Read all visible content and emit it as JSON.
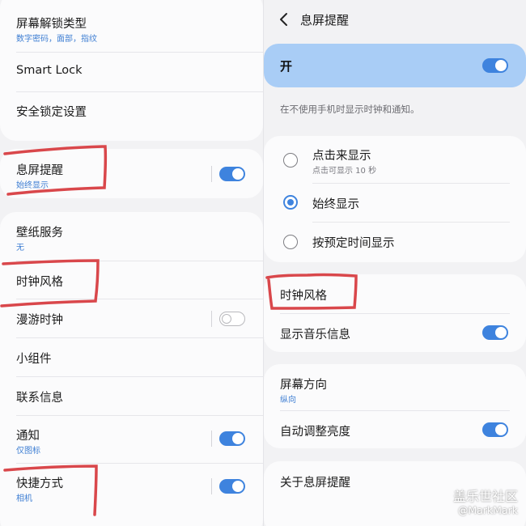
{
  "left": {
    "screen_lock_type": {
      "title": "屏幕解锁类型",
      "subtitle": "数字密码，面部，指纹"
    },
    "smart_lock": {
      "title": "Smart Lock"
    },
    "secure_lock_settings": {
      "title": "安全锁定设置"
    },
    "aod": {
      "title": "息屏提醒",
      "subtitle": "始终显示",
      "toggle_on": true
    },
    "wallpaper_services": {
      "title": "壁纸服务",
      "subtitle": "无"
    },
    "clock_style": {
      "title": "时钟风格"
    },
    "roaming_clock": {
      "title": "漫游时钟",
      "toggle_on": false
    },
    "widgets": {
      "title": "小组件"
    },
    "contact_info": {
      "title": "联系信息"
    },
    "notifications": {
      "title": "通知",
      "subtitle": "仅图标",
      "toggle_on": true
    },
    "shortcuts": {
      "title": "快捷方式",
      "subtitle": "相机",
      "toggle_on": true
    }
  },
  "right": {
    "header": {
      "title": "息屏提醒"
    },
    "master": {
      "label": "开",
      "toggle_on": true
    },
    "description": "在不使用手机时显示时钟和通知。",
    "options": [
      {
        "title": "点击来显示",
        "subtitle": "点击可显示 10 秒",
        "selected": false
      },
      {
        "title": "始终显示",
        "selected": true
      },
      {
        "title": "按预定时间显示",
        "selected": false
      }
    ],
    "clock_style": {
      "title": "时钟风格"
    },
    "music_info": {
      "title": "显示音乐信息",
      "toggle_on": true
    },
    "orientation": {
      "title": "屏幕方向",
      "subtitle": "纵向"
    },
    "auto_brightness": {
      "title": "自动调整亮度",
      "toggle_on": true
    },
    "about": {
      "title": "关于息屏提醒"
    }
  },
  "watermark": {
    "line1": "盖乐世社区",
    "line2": "@MarkMark"
  },
  "colors": {
    "accent": "#3e83de",
    "master_bg": "#a9cdf6",
    "annotation": "#d9474b"
  }
}
